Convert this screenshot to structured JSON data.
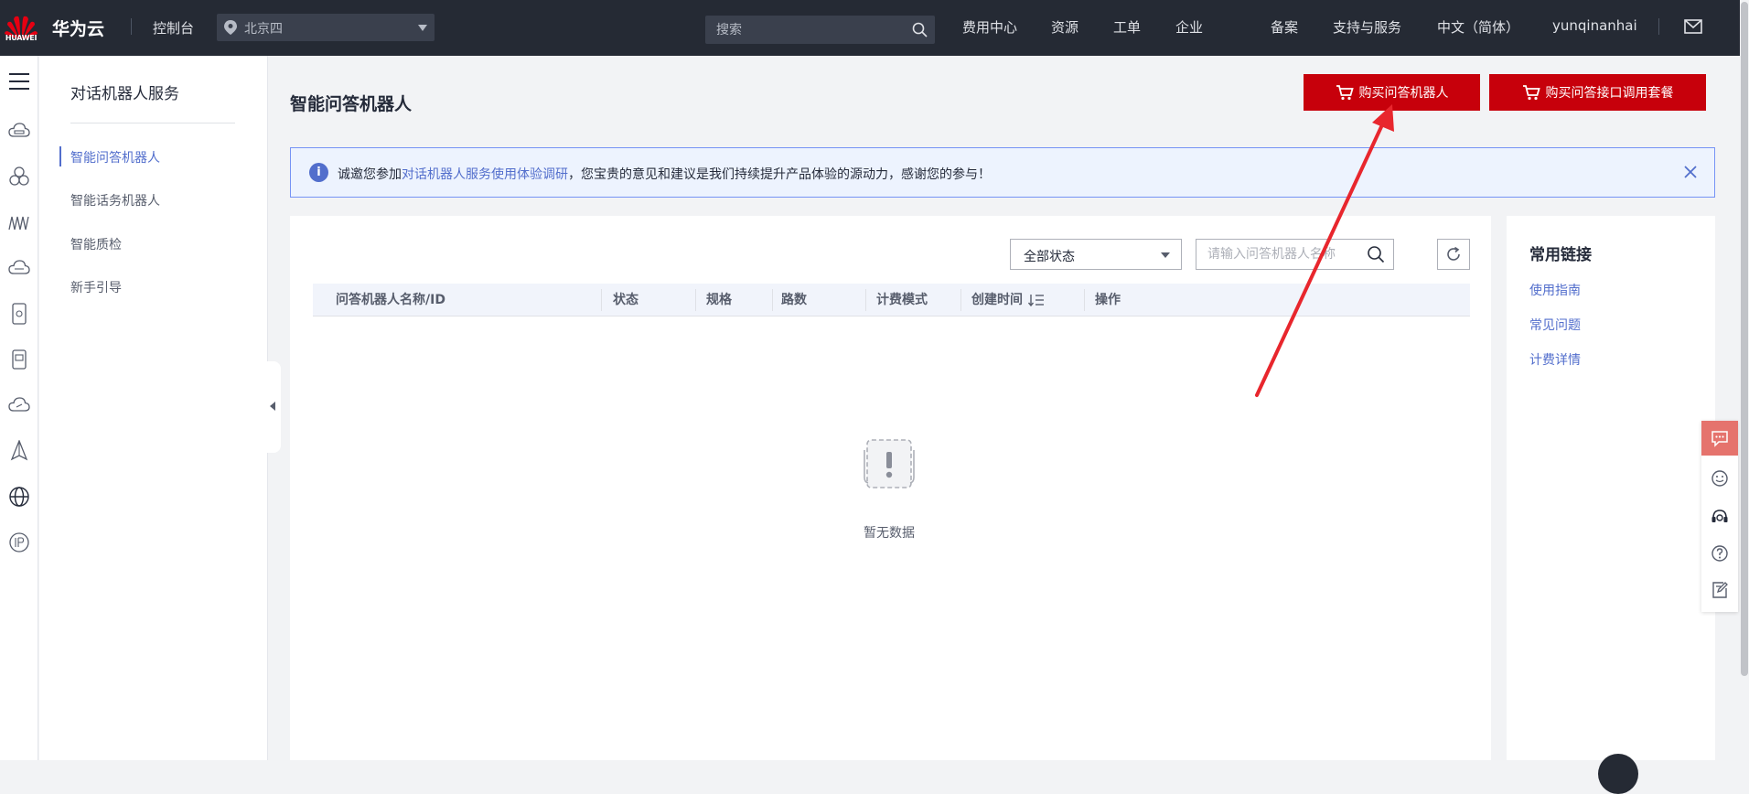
{
  "topbar": {
    "logo_text": "HUAWEI",
    "brand": "华为云",
    "console": "控制台",
    "region": "北京四",
    "search_placeholder": "搜索",
    "nav": [
      "费用中心",
      "资源",
      "工单",
      "企业",
      "备案",
      "支持与服务",
      "中文（简体）",
      "yunqinanhai"
    ]
  },
  "sidebar": {
    "title": "对话机器人服务",
    "items": [
      {
        "label": "智能问答机器人",
        "active": true
      },
      {
        "label": "智能话务机器人",
        "active": false
      },
      {
        "label": "智能质检",
        "active": false
      },
      {
        "label": "新手引导",
        "active": false
      }
    ]
  },
  "page": {
    "title": "智能问答机器人",
    "buy_robot": "购买问答机器人",
    "buy_package": "购买问答接口调用套餐"
  },
  "notice": {
    "prefix": "诚邀您参加",
    "link": "对话机器人服务使用体验调研",
    "suffix": "，您宝贵的意见和建议是我们持续提升产品体验的源动力，感谢您的参与！"
  },
  "filters": {
    "status": "全部状态",
    "name_placeholder": "请输入问答机器人名称"
  },
  "table": {
    "columns": [
      "问答机器人名称/ID",
      "状态",
      "规格",
      "路数",
      "计费模式",
      "创建时间",
      "操作"
    ],
    "rows": [],
    "empty_text": "暂无数据"
  },
  "links": {
    "title": "常用链接",
    "items": [
      "使用指南",
      "常见问题",
      "计费详情"
    ]
  },
  "colors": {
    "topbar": "#252a34",
    "brand_red": "#c7000b",
    "link_blue": "#526ecc",
    "arrow_red": "#e8262d"
  },
  "icons": {
    "rail": [
      "cloud-server-icon",
      "cluster-icon",
      "wave-icon",
      "cloud-db-icon",
      "phone-icon",
      "tablet-icon",
      "cloud-link-icon",
      "tower-icon",
      "globe-icon",
      "ip-icon"
    ],
    "float": [
      "chat-icon",
      "smile-icon",
      "headset-icon",
      "help-icon",
      "feedback-icon"
    ]
  }
}
